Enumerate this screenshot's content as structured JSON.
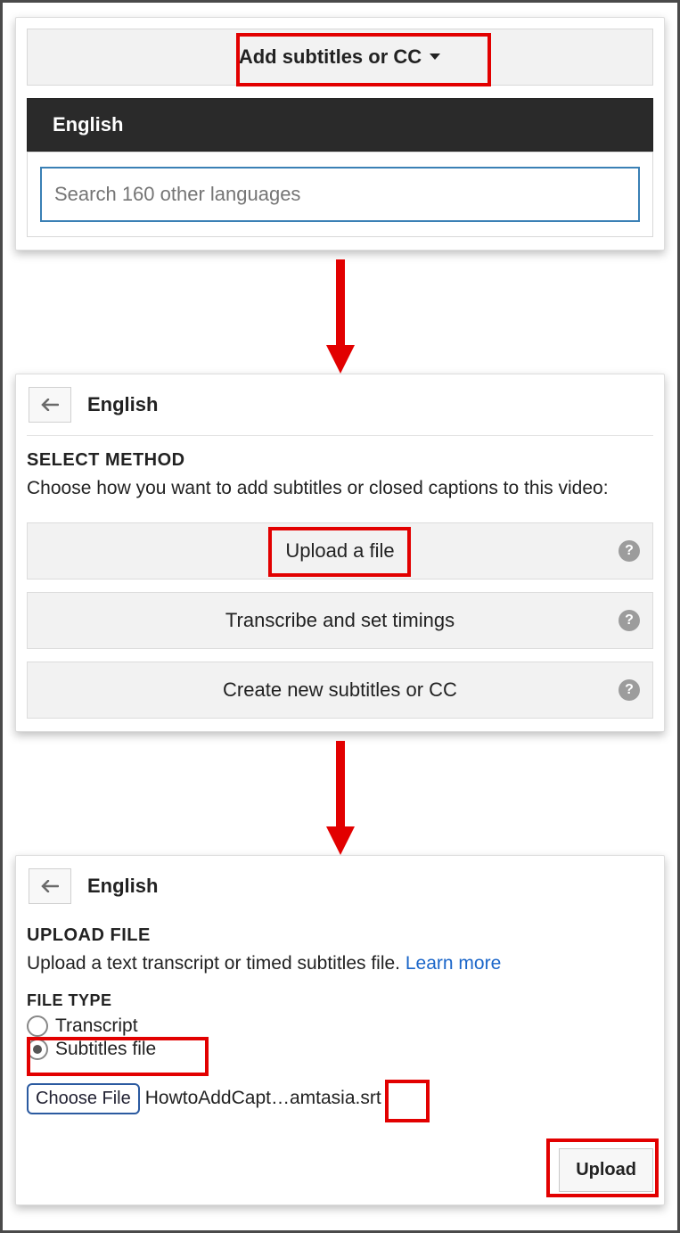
{
  "step1": {
    "dropdown_label": "Add subtitles or CC",
    "clear_symbol": "×",
    "language_banner": "English",
    "search_placeholder": "Search 160 other languages"
  },
  "step2": {
    "back_icon": "←",
    "title": "English",
    "section_label": "SELECT METHOD",
    "instruction": "Choose how you want to add subtitles or closed captions to this video:",
    "methods": {
      "upload": "Upload a file",
      "transcribe": "Transcribe and set timings",
      "create": "Create new subtitles or CC"
    },
    "help_glyph": "?"
  },
  "step3": {
    "back_icon": "←",
    "title": "English",
    "section_label": "UPLOAD FILE",
    "instruction": "Upload a text transcript or timed subtitles file. ",
    "learn_more": "Learn more",
    "file_type_label": "FILE TYPE",
    "radio_transcript": "Transcript",
    "radio_subtitles": "Subtitles file",
    "choose_file_label": "Choose File",
    "selected_file_name": "HowtoAddCapt…amtasia",
    "selected_file_ext": ".srt",
    "upload_label": "Upload"
  }
}
